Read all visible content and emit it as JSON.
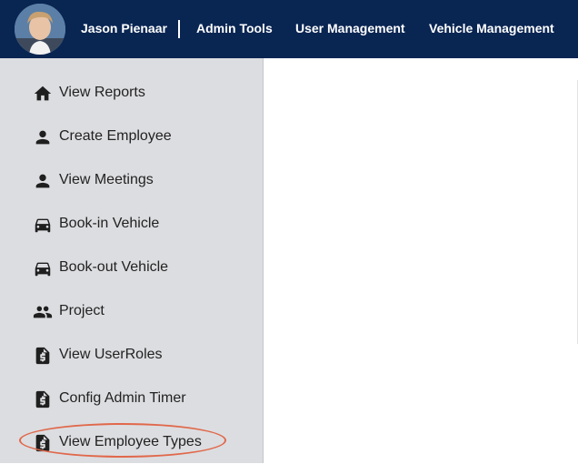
{
  "header": {
    "user_name": "Jason Pienaar",
    "separator": "|",
    "menu": [
      "Admin Tools",
      "User Management",
      "Vehicle Management"
    ]
  },
  "sidebar": {
    "items": [
      {
        "label": "View Reports",
        "icon": "home-icon"
      },
      {
        "label": "Create Employee",
        "icon": "person-icon"
      },
      {
        "label": "View Meetings",
        "icon": "person-icon"
      },
      {
        "label": "Book-in Vehicle",
        "icon": "car-icon"
      },
      {
        "label": "Book-out Vehicle",
        "icon": "car-icon"
      },
      {
        "label": "Project",
        "icon": "people-icon"
      },
      {
        "label": "View UserRoles",
        "icon": "dollar-document-icon"
      },
      {
        "label": "Config Admin Timer",
        "icon": "dollar-document-icon"
      },
      {
        "label": "View Employee Types",
        "icon": "dollar-document-icon"
      }
    ],
    "highlighted_item": "View Employee Types"
  },
  "colors": {
    "header_bg": "#092552",
    "sidebar_bg": "#dcdde0",
    "highlight_ring": "#e0684b",
    "icon": "#1f1f1f"
  }
}
